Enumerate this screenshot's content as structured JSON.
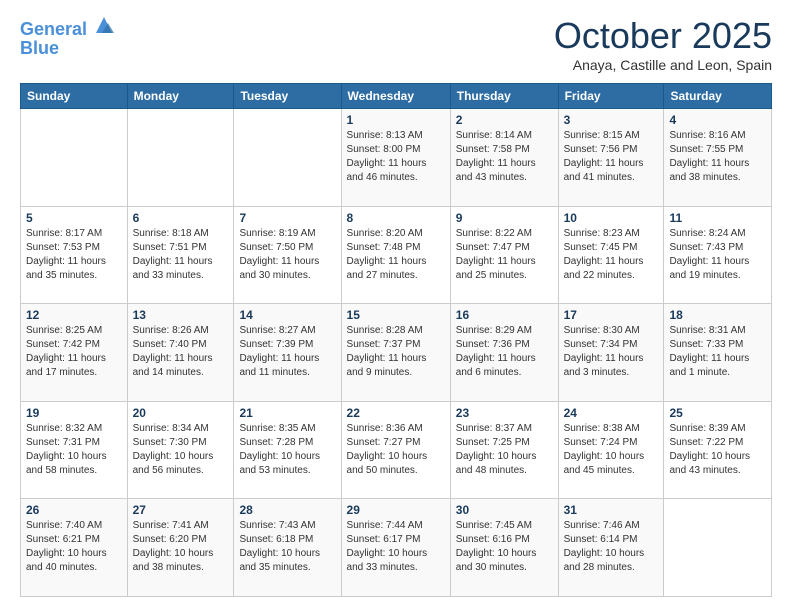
{
  "header": {
    "logo_line1": "General",
    "logo_line2": "Blue",
    "month_title": "October 2025",
    "location": "Anaya, Castille and Leon, Spain"
  },
  "days_of_week": [
    "Sunday",
    "Monday",
    "Tuesday",
    "Wednesday",
    "Thursday",
    "Friday",
    "Saturday"
  ],
  "weeks": [
    [
      {
        "day": "",
        "info": ""
      },
      {
        "day": "",
        "info": ""
      },
      {
        "day": "",
        "info": ""
      },
      {
        "day": "1",
        "info": "Sunrise: 8:13 AM\nSunset: 8:00 PM\nDaylight: 11 hours\nand 46 minutes."
      },
      {
        "day": "2",
        "info": "Sunrise: 8:14 AM\nSunset: 7:58 PM\nDaylight: 11 hours\nand 43 minutes."
      },
      {
        "day": "3",
        "info": "Sunrise: 8:15 AM\nSunset: 7:56 PM\nDaylight: 11 hours\nand 41 minutes."
      },
      {
        "day": "4",
        "info": "Sunrise: 8:16 AM\nSunset: 7:55 PM\nDaylight: 11 hours\nand 38 minutes."
      }
    ],
    [
      {
        "day": "5",
        "info": "Sunrise: 8:17 AM\nSunset: 7:53 PM\nDaylight: 11 hours\nand 35 minutes."
      },
      {
        "day": "6",
        "info": "Sunrise: 8:18 AM\nSunset: 7:51 PM\nDaylight: 11 hours\nand 33 minutes."
      },
      {
        "day": "7",
        "info": "Sunrise: 8:19 AM\nSunset: 7:50 PM\nDaylight: 11 hours\nand 30 minutes."
      },
      {
        "day": "8",
        "info": "Sunrise: 8:20 AM\nSunset: 7:48 PM\nDaylight: 11 hours\nand 27 minutes."
      },
      {
        "day": "9",
        "info": "Sunrise: 8:22 AM\nSunset: 7:47 PM\nDaylight: 11 hours\nand 25 minutes."
      },
      {
        "day": "10",
        "info": "Sunrise: 8:23 AM\nSunset: 7:45 PM\nDaylight: 11 hours\nand 22 minutes."
      },
      {
        "day": "11",
        "info": "Sunrise: 8:24 AM\nSunset: 7:43 PM\nDaylight: 11 hours\nand 19 minutes."
      }
    ],
    [
      {
        "day": "12",
        "info": "Sunrise: 8:25 AM\nSunset: 7:42 PM\nDaylight: 11 hours\nand 17 minutes."
      },
      {
        "day": "13",
        "info": "Sunrise: 8:26 AM\nSunset: 7:40 PM\nDaylight: 11 hours\nand 14 minutes."
      },
      {
        "day": "14",
        "info": "Sunrise: 8:27 AM\nSunset: 7:39 PM\nDaylight: 11 hours\nand 11 minutes."
      },
      {
        "day": "15",
        "info": "Sunrise: 8:28 AM\nSunset: 7:37 PM\nDaylight: 11 hours\nand 9 minutes."
      },
      {
        "day": "16",
        "info": "Sunrise: 8:29 AM\nSunset: 7:36 PM\nDaylight: 11 hours\nand 6 minutes."
      },
      {
        "day": "17",
        "info": "Sunrise: 8:30 AM\nSunset: 7:34 PM\nDaylight: 11 hours\nand 3 minutes."
      },
      {
        "day": "18",
        "info": "Sunrise: 8:31 AM\nSunset: 7:33 PM\nDaylight: 11 hours\nand 1 minute."
      }
    ],
    [
      {
        "day": "19",
        "info": "Sunrise: 8:32 AM\nSunset: 7:31 PM\nDaylight: 10 hours\nand 58 minutes."
      },
      {
        "day": "20",
        "info": "Sunrise: 8:34 AM\nSunset: 7:30 PM\nDaylight: 10 hours\nand 56 minutes."
      },
      {
        "day": "21",
        "info": "Sunrise: 8:35 AM\nSunset: 7:28 PM\nDaylight: 10 hours\nand 53 minutes."
      },
      {
        "day": "22",
        "info": "Sunrise: 8:36 AM\nSunset: 7:27 PM\nDaylight: 10 hours\nand 50 minutes."
      },
      {
        "day": "23",
        "info": "Sunrise: 8:37 AM\nSunset: 7:25 PM\nDaylight: 10 hours\nand 48 minutes."
      },
      {
        "day": "24",
        "info": "Sunrise: 8:38 AM\nSunset: 7:24 PM\nDaylight: 10 hours\nand 45 minutes."
      },
      {
        "day": "25",
        "info": "Sunrise: 8:39 AM\nSunset: 7:22 PM\nDaylight: 10 hours\nand 43 minutes."
      }
    ],
    [
      {
        "day": "26",
        "info": "Sunrise: 7:40 AM\nSunset: 6:21 PM\nDaylight: 10 hours\nand 40 minutes."
      },
      {
        "day": "27",
        "info": "Sunrise: 7:41 AM\nSunset: 6:20 PM\nDaylight: 10 hours\nand 38 minutes."
      },
      {
        "day": "28",
        "info": "Sunrise: 7:43 AM\nSunset: 6:18 PM\nDaylight: 10 hours\nand 35 minutes."
      },
      {
        "day": "29",
        "info": "Sunrise: 7:44 AM\nSunset: 6:17 PM\nDaylight: 10 hours\nand 33 minutes."
      },
      {
        "day": "30",
        "info": "Sunrise: 7:45 AM\nSunset: 6:16 PM\nDaylight: 10 hours\nand 30 minutes."
      },
      {
        "day": "31",
        "info": "Sunrise: 7:46 AM\nSunset: 6:14 PM\nDaylight: 10 hours\nand 28 minutes."
      },
      {
        "day": "",
        "info": ""
      }
    ]
  ]
}
